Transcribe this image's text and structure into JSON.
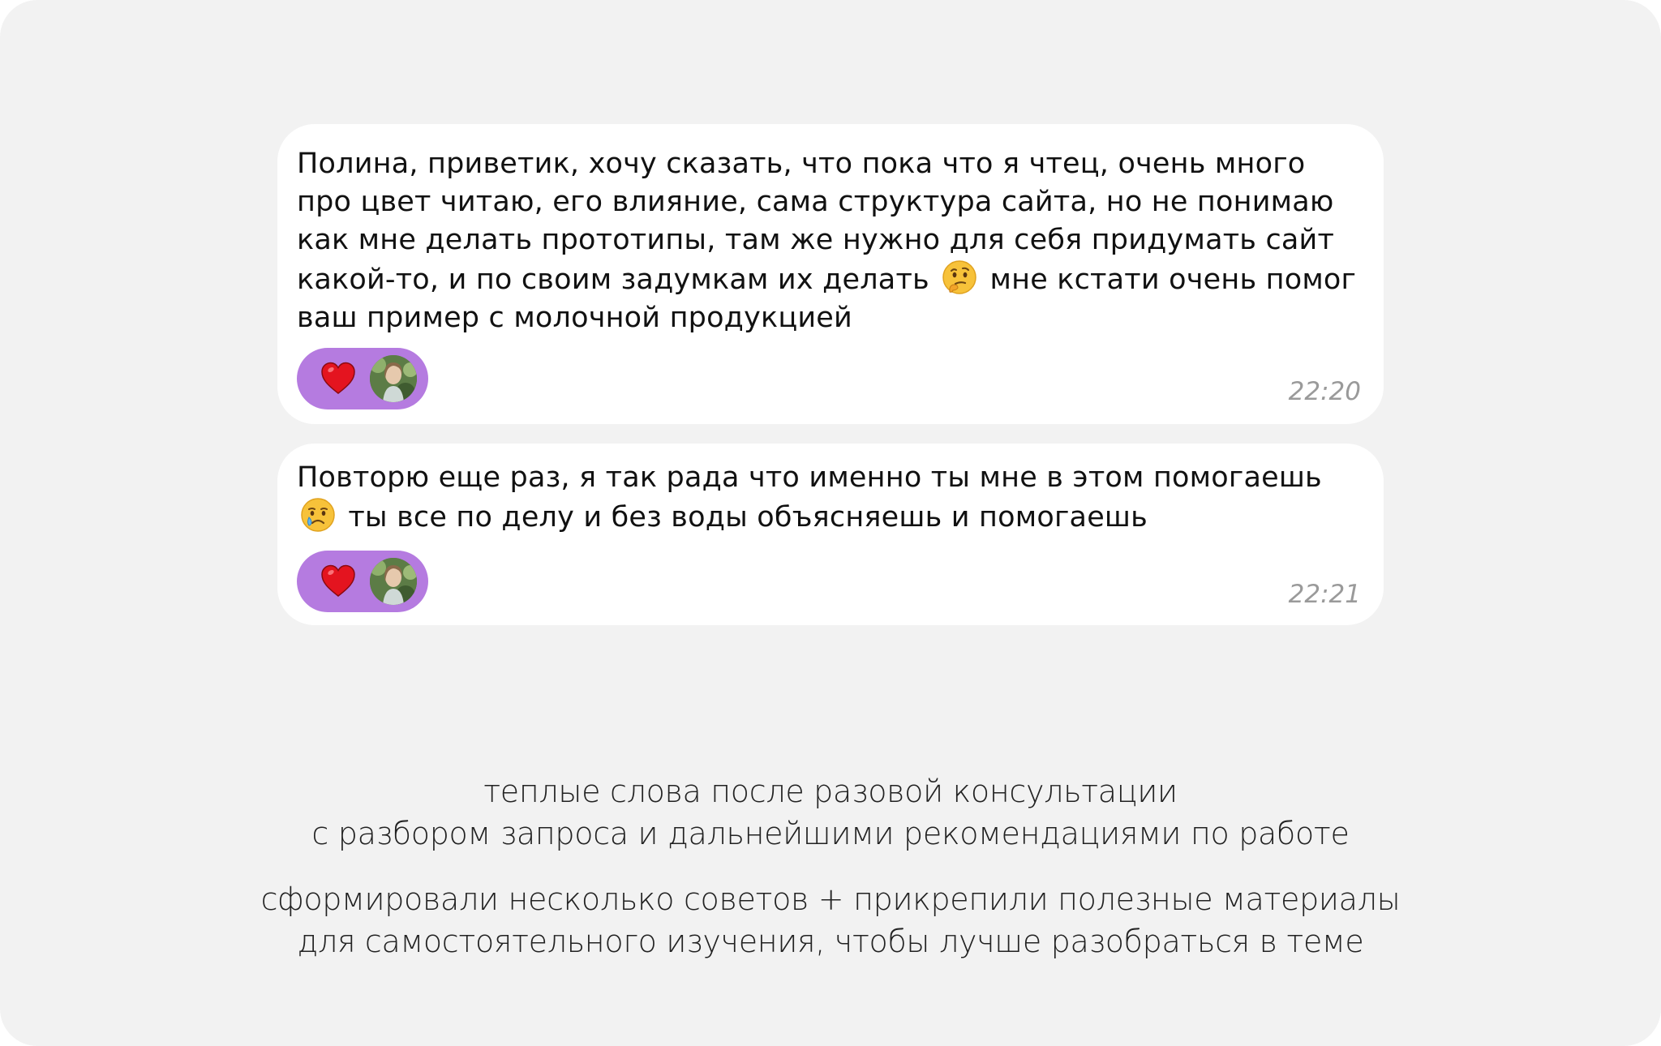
{
  "messages": [
    {
      "text_before_emoji": "Полина, приветик, хочу сказать, что пока что я чтец, очень много про цвет читаю, его влияние, сама структура сайта, но не понимаю как мне делать прототипы, там же нужно для себя придумать сайт какой-то, и по своим задумкам их делать",
      "emoji": "thinking-face-emoji",
      "text_after_emoji": "мне кстати очень помог ваш пример с молочной продукцией",
      "reaction": {
        "emoji": "heart-icon",
        "color": "#b57be0"
      },
      "time": "22:20"
    },
    {
      "text_before_emoji": "Повторю еще раз, я так рада что именно ты мне в этом помогаешь",
      "emoji": "crying-face-emoji",
      "text_after_emoji": "ты все по делу и без воды объясняешь и помогаешь",
      "reaction": {
        "emoji": "heart-icon",
        "color": "#b57be0"
      },
      "time": "22:21"
    }
  ],
  "caption": {
    "block1_line1": "теплые слова после разовой консультации",
    "block1_line2": "с разбором запроса и дальнейшими рекомендациями по работе",
    "block2_line1": "сформировали несколько советов + прикрепили полезные материалы",
    "block2_line2": "для самостоятельного изучения, чтобы лучше разобраться в теме"
  },
  "colors": {
    "background": "#f2f2f2",
    "bubble": "#ffffff",
    "reaction_pill": "#b57be0",
    "timestamp": "#9a9a9a"
  }
}
